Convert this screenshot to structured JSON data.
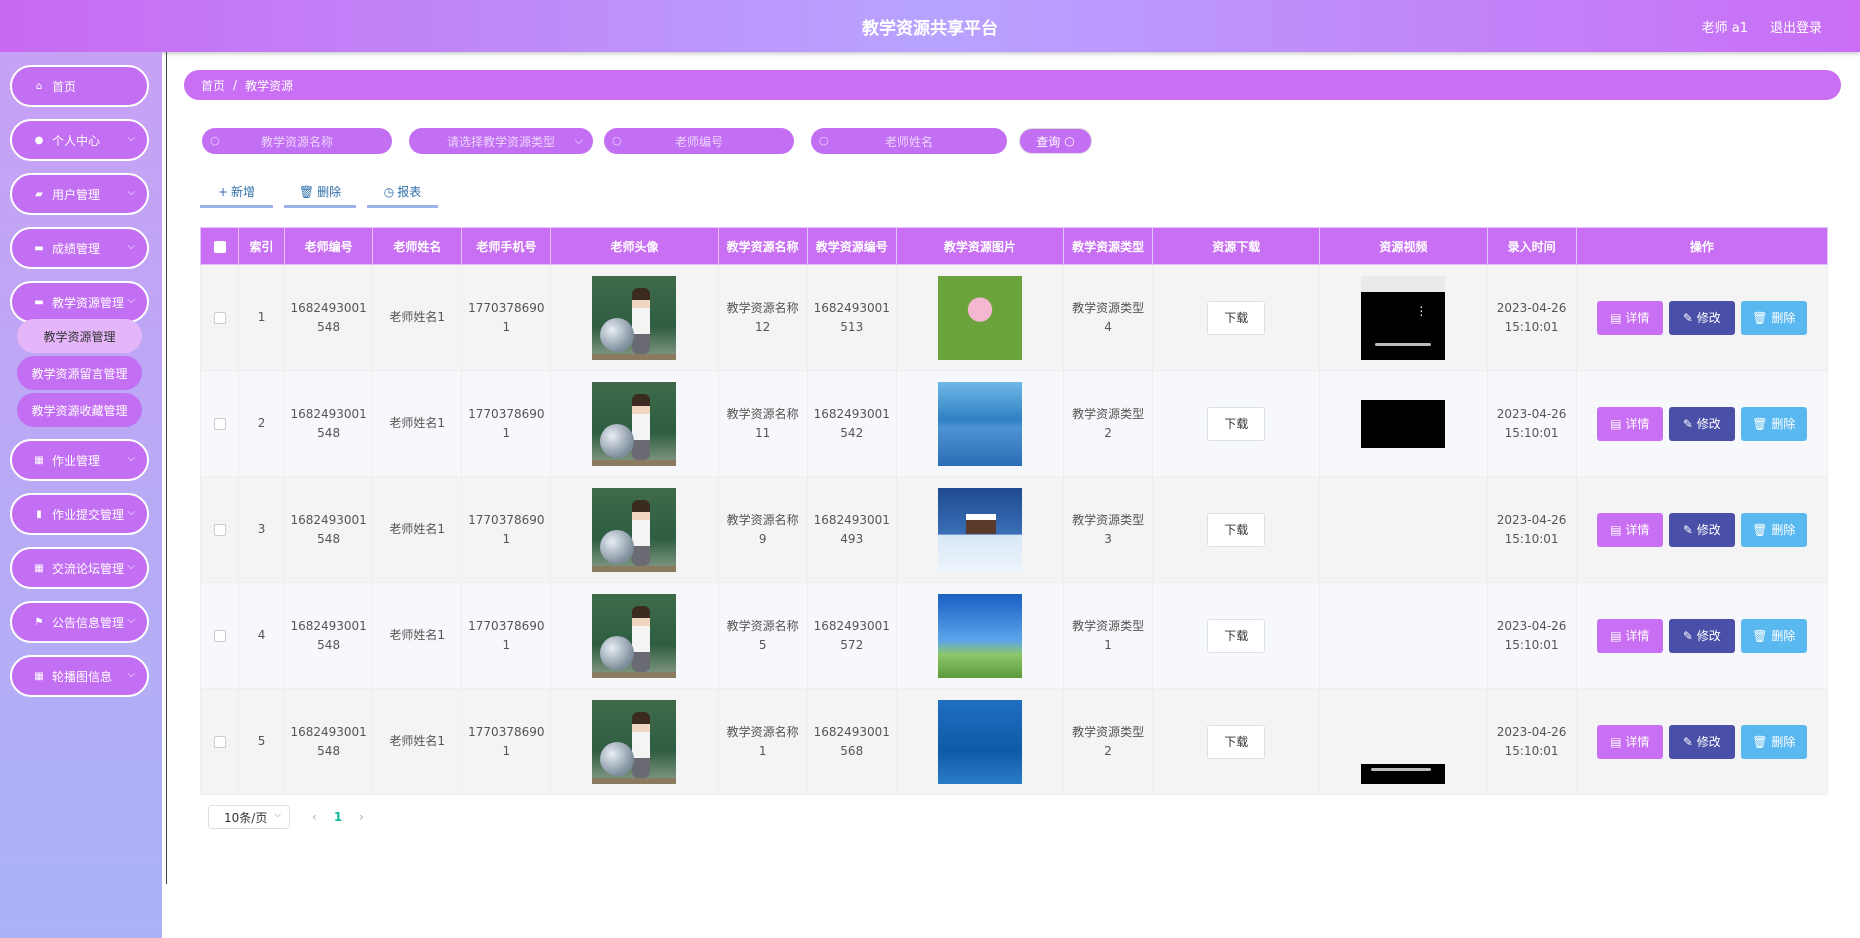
{
  "header": {
    "title": "教学资源共享平台",
    "user": "老师 a1",
    "logout": "退出登录"
  },
  "sidebar": {
    "items": [
      {
        "label": "首页",
        "icon": "home-icon",
        "glyph": "⌂"
      },
      {
        "label": "个人中心",
        "icon": "user-icon",
        "glyph": "●"
      },
      {
        "label": "用户管理",
        "icon": "folder-icon",
        "glyph": "▰"
      },
      {
        "label": "成绩管理",
        "icon": "comment-icon",
        "glyph": "▬"
      },
      {
        "label": "教学资源管理",
        "icon": "ticket-icon",
        "glyph": "▬"
      },
      {
        "label": "作业管理",
        "icon": "grid-icon",
        "glyph": "▦"
      },
      {
        "label": "作业提交管理",
        "icon": "chart-icon",
        "glyph": "▮"
      },
      {
        "label": "交流论坛管理",
        "icon": "grid-icon",
        "glyph": "▦"
      },
      {
        "label": "公告信息管理",
        "icon": "flag-icon",
        "glyph": "⚑"
      },
      {
        "label": "轮播图信息",
        "icon": "grid-icon",
        "glyph": "▦"
      }
    ],
    "subitems": [
      "教学资源管理",
      "教学资源留言管理",
      "教学资源收藏管理"
    ]
  },
  "breadcrumb": {
    "home": "首页",
    "current": "教学资源"
  },
  "search": {
    "name_placeholder": "教学资源名称",
    "type_placeholder": "请选择教学资源类型",
    "no_placeholder": "老师编号",
    "teacher_placeholder": "老师姓名",
    "query": "查询"
  },
  "actions": {
    "add": "新增",
    "delete": "删除",
    "report": "报表"
  },
  "table": {
    "columns": [
      "索引",
      "老师编号",
      "老师姓名",
      "老师手机号",
      "老师头像",
      "教学资源名称",
      "教学资源编号",
      "教学资源图片",
      "教学资源类型",
      "资源下载",
      "资源视频",
      "录入时间",
      "操作"
    ],
    "rows": [
      {
        "index": "1",
        "tno1": "1682493001",
        "tno2": "548",
        "tname": "老师姓名1",
        "phone1": "1770378690",
        "phone2": "1",
        "rname1": "教学资源名称",
        "rname2": "12",
        "rno1": "1682493001",
        "rno2": "513",
        "rtype1": "教学资源类型",
        "rtype2": "4",
        "date": "2023-04-26",
        "time": "15:10:01"
      },
      {
        "index": "2",
        "tno1": "1682493001",
        "tno2": "548",
        "tname": "老师姓名1",
        "phone1": "1770378690",
        "phone2": "1",
        "rname1": "教学资源名称",
        "rname2": "11",
        "rno1": "1682493001",
        "rno2": "542",
        "rtype1": "教学资源类型",
        "rtype2": "2",
        "date": "2023-04-26",
        "time": "15:10:01"
      },
      {
        "index": "3",
        "tno1": "1682493001",
        "tno2": "548",
        "tname": "老师姓名1",
        "phone1": "1770378690",
        "phone2": "1",
        "rname1": "教学资源名称",
        "rname2": "9",
        "rno1": "1682493001",
        "rno2": "493",
        "rtype1": "教学资源类型",
        "rtype2": "3",
        "date": "2023-04-26",
        "time": "15:10:01"
      },
      {
        "index": "4",
        "tno1": "1682493001",
        "tno2": "548",
        "tname": "老师姓名1",
        "phone1": "1770378690",
        "phone2": "1",
        "rname1": "教学资源名称",
        "rname2": "5",
        "rno1": "1682493001",
        "rno2": "572",
        "rtype1": "教学资源类型",
        "rtype2": "1",
        "date": "2023-04-26",
        "time": "15:10:01"
      },
      {
        "index": "5",
        "tno1": "1682493001",
        "tno2": "548",
        "tname": "老师姓名1",
        "phone1": "1770378690",
        "phone2": "1",
        "rname1": "教学资源名称",
        "rname2": "1",
        "rno1": "1682493001",
        "rno2": "568",
        "rtype1": "教学资源类型",
        "rtype2": "2",
        "date": "2023-04-26",
        "time": "15:10:01"
      }
    ],
    "download": "下载",
    "op_detail": "详情",
    "op_edit": "修改",
    "op_delete": "删除"
  },
  "pagination": {
    "pagesize": "10条/页",
    "current": "1"
  },
  "colors": {
    "accent": "#c86ff3",
    "edit": "#4a4fa8",
    "delete": "#5ab8f0",
    "active_page": "#14b89a"
  }
}
